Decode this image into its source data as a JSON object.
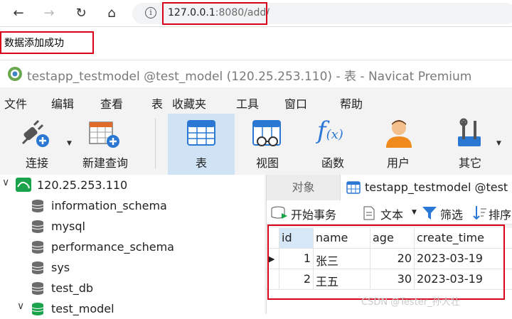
{
  "browser": {
    "back_label": "←",
    "forward_label": "→",
    "reload_label": "↻",
    "home_label": "⌂",
    "url_host": "127.0.0.1",
    "url_rest": ":8080/add/"
  },
  "response": {
    "text": "数据添加成功"
  },
  "navicat": {
    "title": "testapp_testmodel @test_model (120.25.253.110) - 表 - Navicat Premium",
    "menu": [
      "文件",
      "编辑",
      "查看",
      "表",
      "收藏夹",
      "工具",
      "窗口",
      "帮助"
    ],
    "toolbar": {
      "connect": "连接",
      "new_query": "新建查询",
      "table": "表",
      "view": "视图",
      "function": "函数",
      "user": "用户",
      "other": "其它"
    },
    "tree": {
      "connection": "120.25.253.110",
      "databases": [
        "information_schema",
        "mysql",
        "performance_schema",
        "sys",
        "test_db",
        "test_model"
      ]
    },
    "tabs": {
      "objects": "对象",
      "table_tab": "testapp_testmodel @test"
    },
    "subtoolbar": {
      "begin_tx": "开始事务",
      "text": "文本",
      "filter": "筛选",
      "sort": "排序"
    },
    "grid": {
      "columns": [
        "id",
        "name",
        "age",
        "create_time"
      ],
      "rows": [
        {
          "id": "1",
          "name": "张三",
          "age": "20",
          "create_time": "2023-03-19"
        },
        {
          "id": "2",
          "name": "王五",
          "age": "30",
          "create_time": "2023-03-19"
        }
      ]
    }
  },
  "watermark": "CSDN @Tester_孙大壮",
  "colors": {
    "highlight_red": "#d9001b",
    "selected_blue": "#cfe3f4",
    "db_green": "#1aa34a"
  }
}
